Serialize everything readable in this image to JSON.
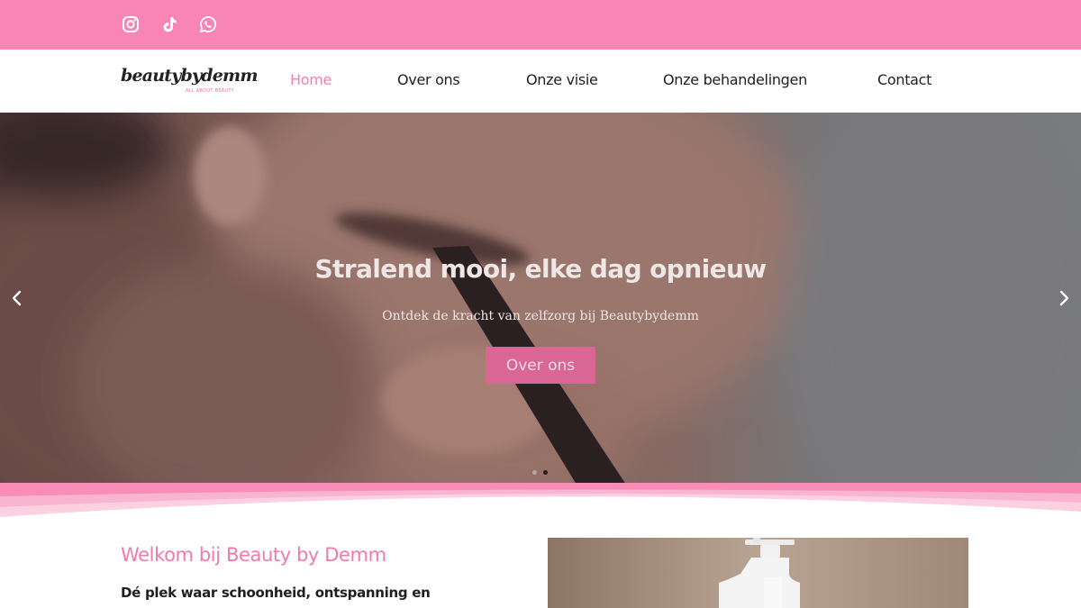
{
  "colors": {
    "brand_pink": "#f985b6",
    "nav_active": "#f47fae",
    "button_bg": "#d96694",
    "heading_pink": "#f07bab"
  },
  "social": [
    {
      "icon": "instagram-icon"
    },
    {
      "icon": "tiktok-icon"
    },
    {
      "icon": "whatsapp-icon"
    }
  ],
  "logo": {
    "word": "beautybydemm",
    "tagline": "ALL ABOUT BEAUTY"
  },
  "nav": {
    "items": [
      "Home",
      "Over ons",
      "Onze visie",
      "Onze behandelingen",
      "Contact"
    ],
    "active": "Home"
  },
  "hero": {
    "title": "Stralend mooi, elke dag opnieuw",
    "subtitle": "Ontdek de kracht van zelfzorg bij Beautybydemm",
    "button_label": "Over ons",
    "prev_icon": "chevron-left-icon",
    "next_icon": "chevron-right-icon",
    "slide_count": 2,
    "active_slide": 2
  },
  "welcome": {
    "title": "Welkom bij Beauty by Demm",
    "text": "Dé plek waar schoonheid, ontspanning en"
  }
}
